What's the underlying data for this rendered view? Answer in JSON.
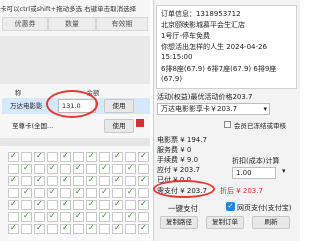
{
  "left": {
    "top_line": "卡可以ctrl或shift+拖动多选 右键单击取消选择",
    "headers": [
      "优惠券",
      "数量",
      "有效期"
    ],
    "columns": [
      "称",
      "余额"
    ],
    "rows": [
      {
        "name": "万达电影影",
        "amount": "131.0",
        "action": "使用"
      },
      {
        "name": "至尊卡(全国...",
        "amount": "",
        "action": "使用"
      }
    ]
  },
  "order": {
    "lines": [
      "订单信息：1318953712",
      "北京颐映影城慕平会生汇店",
      "1号厅-停车免费",
      "你想活出怎样的人生 2024-04-26",
      "15:15:00",
      "6排8座(67.9) 6排7座(67.9) 6排9座",
      "(67.9)"
    ]
  },
  "right": {
    "activity_label": "活动(权益)最优活动价格203.7",
    "activity_value": "万达电影影享卡￥203.7",
    "member_check": "会员已冻结或审核",
    "prices": [
      "电影票 ¥ 194.7",
      "服务费 ¥ 0",
      "手续费 ¥ 9.0",
      "应付 ¥ 203.7",
      "已付 ¥ 0.0"
    ],
    "discount_label": "折扣(成本)计算",
    "discount_value": "1.00",
    "due": "需支付 ¥ 203.7",
    "discount_price": "折后 ¥ 203.7",
    "one_click": "一键支付",
    "web_pay": "网页支付(支付宝)",
    "copy_path": "复制路径",
    "copy_order": "复制订单",
    "refresh": "刷新"
  },
  "colors": {
    "highlight": "#e53935",
    "check": "#1e88e5"
  }
}
